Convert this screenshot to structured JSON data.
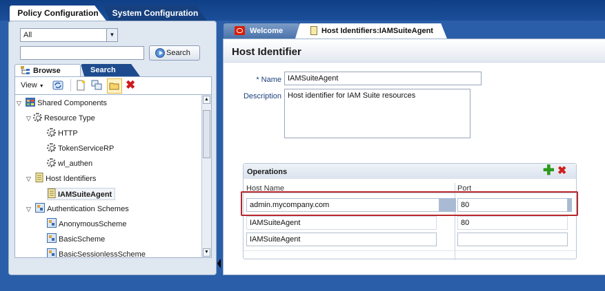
{
  "top_tabs": [
    "Policy Configuration",
    "System Configuration"
  ],
  "nav": {
    "scope_value": "All",
    "search_button": "Search",
    "tabs": [
      "Browse",
      "Search"
    ],
    "view_menu": "View"
  },
  "tree": [
    {
      "label": "Shared Components",
      "icon": "grid-icon",
      "expanded": true
    },
    {
      "label": "Resource Type",
      "icon": "gear-icon",
      "expanded": true
    },
    {
      "label": "HTTP",
      "icon": "gear-icon"
    },
    {
      "label": "TokenServiceRP",
      "icon": "gear-icon"
    },
    {
      "label": "wl_authen",
      "icon": "gear-icon"
    },
    {
      "label": "Host Identifiers",
      "icon": "document-icon",
      "expanded": true
    },
    {
      "label": "IAMSuiteAgent",
      "icon": "document-icon",
      "selected": true
    },
    {
      "label": "Authentication Schemes",
      "icon": "scheme-icon",
      "expanded": true
    },
    {
      "label": "AnonymousScheme",
      "icon": "scheme-icon"
    },
    {
      "label": "BasicScheme",
      "icon": "scheme-icon"
    },
    {
      "label": "BasicSessionlessScheme",
      "icon": "scheme-icon"
    }
  ],
  "doc_tabs": [
    "Welcome",
    "Host Identifiers:IAMSuiteAgent"
  ],
  "editor": {
    "title": "Host Identifier",
    "required_mark": "*",
    "name_label": "Name",
    "name_value": "IAMSuiteAgent",
    "description_label": "Description",
    "description_value": "Host identifier for IAM Suite resources"
  },
  "operations": {
    "title": "Operations",
    "columns": [
      "Host Name",
      "Port"
    ],
    "rows": [
      {
        "host": "admin.mycompany.com",
        "port": "80",
        "selected": true
      },
      {
        "host": "IAMSuiteAgent",
        "port": "80"
      },
      {
        "host": "IAMSuiteAgent",
        "port": ""
      }
    ]
  },
  "colors": {
    "frame_blue": "#2a5ea8",
    "panel_bg": "#dfe7f1",
    "label_blue": "#1c3f7a",
    "selection_border": "#b9262b",
    "add_green": "#2c9a1c",
    "delete_red": "#d21f1f"
  }
}
